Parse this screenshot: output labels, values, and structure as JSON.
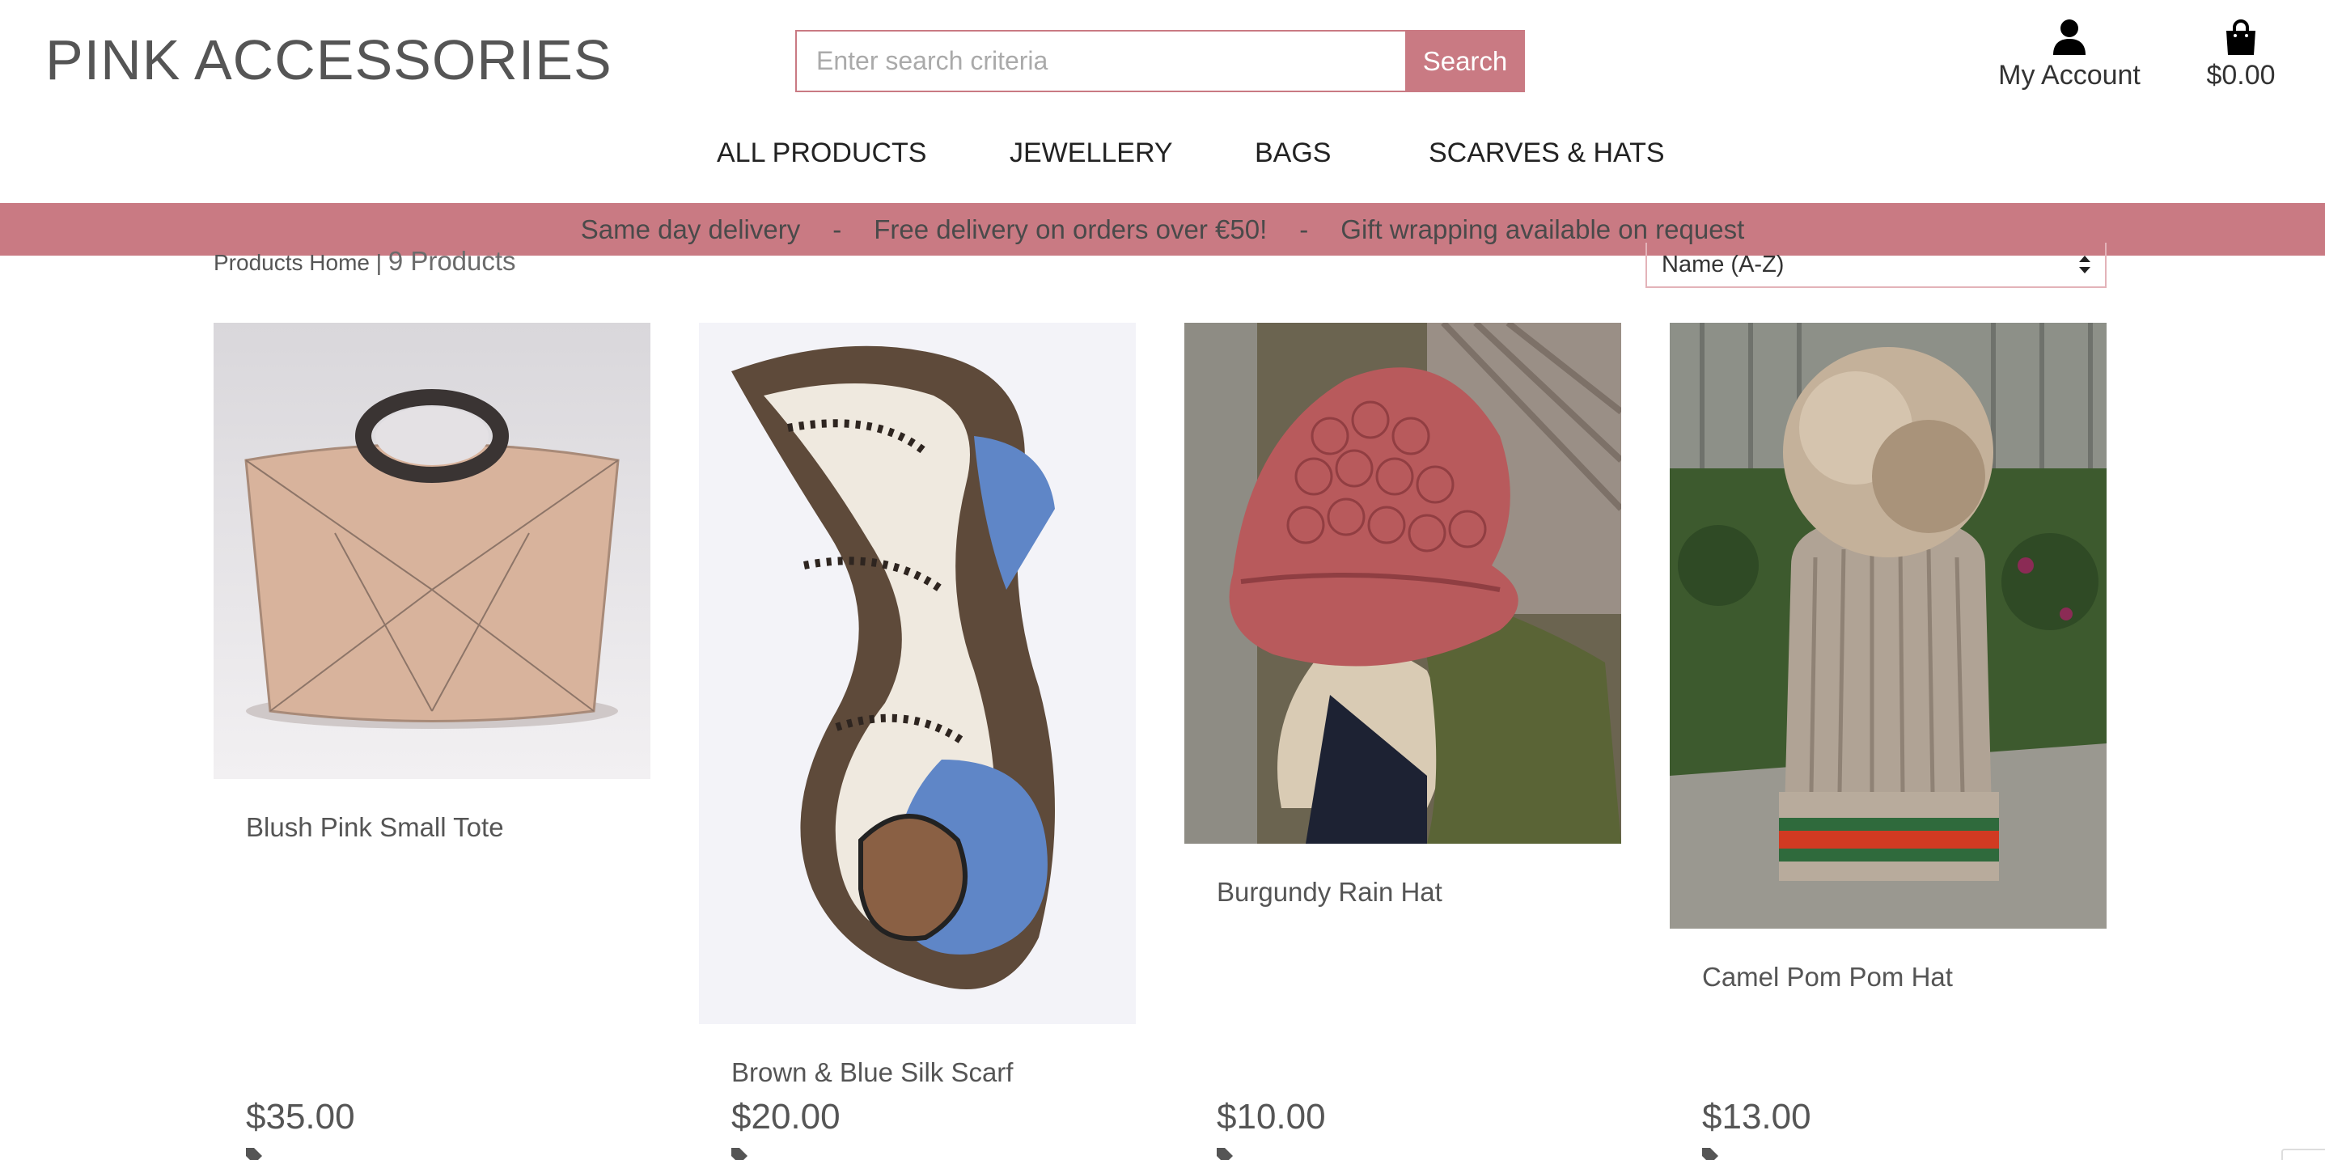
{
  "header": {
    "brand": "PINK ACCESSORIES",
    "search_placeholder": "Enter search criteria",
    "search_button": "Search",
    "account_label": "My Account",
    "cart_total": "$0.00"
  },
  "nav": {
    "items": [
      "ALL PRODUCTS",
      "JEWELLERY",
      "BAGS",
      "SCARVES & HATS"
    ]
  },
  "promo": {
    "items": [
      "Same day delivery",
      "Free delivery on orders over €50!",
      "Gift wrapping available on request"
    ],
    "separator": "-"
  },
  "listing": {
    "breadcrumb": "Products Home",
    "divider": "|",
    "count": "9 Products",
    "sort_selected": "Name (A-Z)"
  },
  "products": [
    {
      "name": "Blush Pink Small Tote",
      "price": "$35.00",
      "image": "blush-pink-tote-bag-photo"
    },
    {
      "name": "Brown & Blue Silk Scarf",
      "price": "$20.00",
      "image": "brown-blue-silk-scarf-photo"
    },
    {
      "name": "Burgundy Rain Hat",
      "price": "$10.00",
      "image": "burgundy-quilted-rain-hat-photo"
    },
    {
      "name": "Camel Pom Pom Hat",
      "price": "$13.00",
      "image": "camel-knit-pom-pom-hat-photo"
    }
  ],
  "icons": {
    "account": "user-icon",
    "cart": "shopping-bag-icon",
    "tag": "tag-icon"
  },
  "colors": {
    "accent": "#c97a83",
    "text": "#555555"
  }
}
